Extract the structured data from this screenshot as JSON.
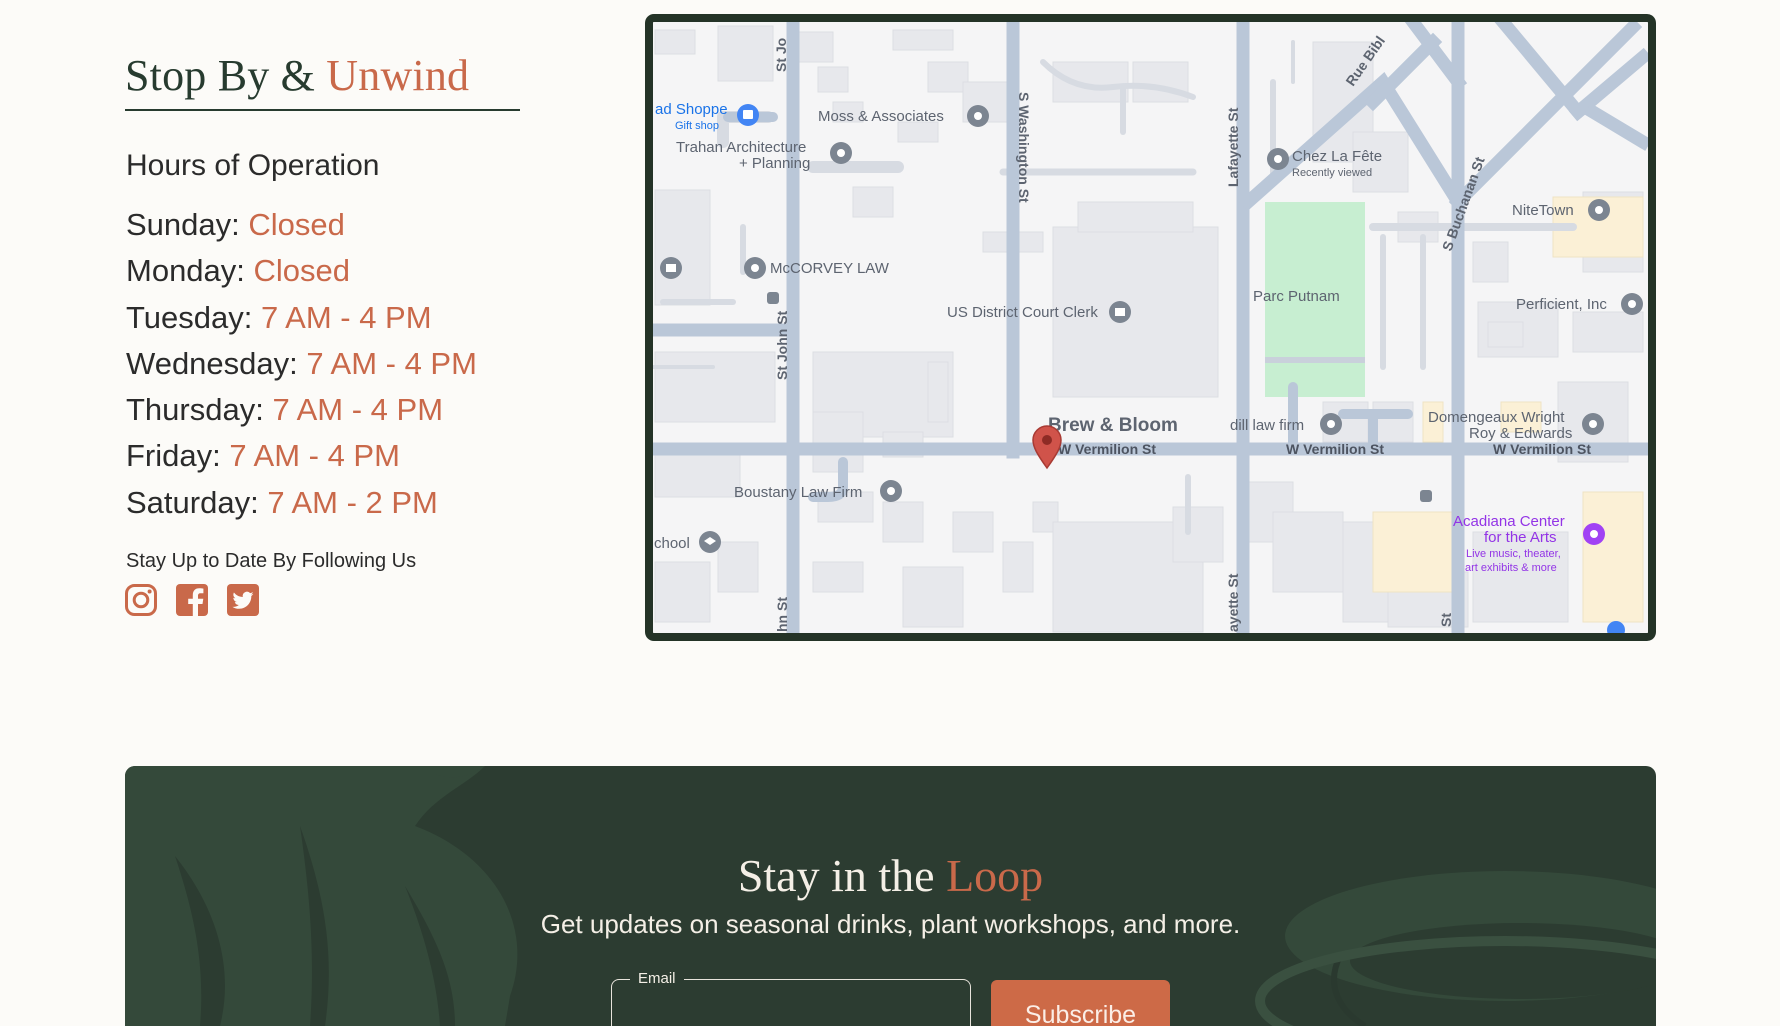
{
  "visit": {
    "title_part1": "Stop By & ",
    "title_part2": "Unwind",
    "hours_heading": "Hours of Operation",
    "hours": [
      {
        "day": "Sunday:",
        "time": "Closed"
      },
      {
        "day": "Monday:",
        "time": "Closed"
      },
      {
        "day": "Tuesday:",
        "time": "7 AM - 4 PM"
      },
      {
        "day": "Wednesday:",
        "time": "7 AM - 4 PM"
      },
      {
        "day": "Thursday:",
        "time": "7 AM - 4 PM"
      },
      {
        "day": "Friday:",
        "time": "7 AM - 4 PM"
      },
      {
        "day": "Saturday:",
        "time": "7 AM - 2 PM"
      }
    ],
    "follow_text": "Stay Up to Date By Following Us",
    "social_icons": [
      "instagram-icon",
      "facebook-icon",
      "twitter-icon"
    ]
  },
  "map": {
    "pin_label": "Brew & Bloom",
    "streets": {
      "main": "W Vermilion St",
      "st_john": "St John St",
      "st_jo": "St Jo",
      "hn_st": "hn St",
      "washington": "S Washington St",
      "lafayette": "Lafayette St",
      "ayette": "ayette St",
      "buchanan": "S Buchanan St",
      "st_bottom": "St",
      "rue": "Rue Bibl"
    },
    "places": {
      "gift_shop": "ad Shoppe",
      "gift_shop_sub": "Gift shop",
      "moss": "Moss & Associates",
      "trahan1": "Trahan Architecture",
      "trahan2": "+ Planning",
      "chez": "Chez La Fête",
      "chez_sub": "Recently viewed",
      "nitetown": "NiteTown",
      "mccorvey": "McCORVEY LAW",
      "court": "US District Court Clerk",
      "parc": "Parc Putnam",
      "perficient": "Perficient, Inc",
      "dill": "dill law firm",
      "domengeaux1": "Domengeaux Wright",
      "domengeaux2": "Roy & Edwards",
      "boustany": "Boustany Law Firm",
      "school": "chool",
      "acadiana1": "Acadiana Center",
      "acadiana2": "for the Arts",
      "acadiana3": "Live music, theater,",
      "acadiana4": "art exhibits & more"
    }
  },
  "newsletter": {
    "title_part1": "Stay in the ",
    "title_part2": "Loop",
    "subtitle": "Get updates on seasonal drinks, plant workshops, and more.",
    "email_label": "Email",
    "email_value": "",
    "subscribe_label": "Subscribe"
  },
  "colors": {
    "accent": "#c9694a",
    "dark_green": "#2c3c31",
    "background": "#fcfbf8",
    "map_pin": "#d0534a",
    "park": "#c7eed1"
  }
}
